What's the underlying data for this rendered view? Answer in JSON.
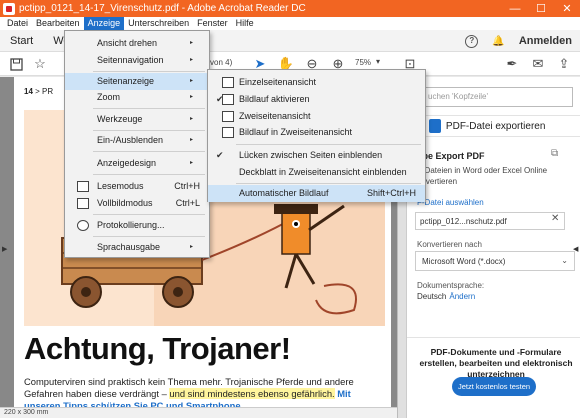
{
  "window": {
    "title": "pctipp_0121_14-17_Virenschutz.pdf - Adobe Acrobat Reader DC",
    "minimize": "—",
    "maximize": "☐",
    "close": "✕"
  },
  "menubar": [
    "Datei",
    "Bearbeiten",
    "Anzeige",
    "Unterschreiben",
    "Fenster",
    "Hilfe"
  ],
  "nav": {
    "tabs": [
      "Start",
      "Werk"
    ],
    "anmelden": "Anmelden",
    "help_icon": "?",
    "bell_icon": "🔔"
  },
  "toolbar": {
    "page_indicator": "von 4)",
    "zoom": "75%",
    "zoom_dropdown": "▾"
  },
  "document": {
    "breadcrumb_num": "14",
    "breadcrumb_text": "> PR",
    "headline": "Achtung, Trojaner!",
    "body_plain1": "Computerviren sind praktisch kein Thema mehr. Trojanische Pferde und andere Gefahren haben diese verdrängt – ",
    "body_highlight": "und sind mindestens ebenso gefährlich.",
    "body_link": " Mit unseren Tipps schützen Sie PC und Smartphone"
  },
  "statusbar": {
    "size": "220 x 300 mm"
  },
  "anzeige_menu": {
    "items": [
      {
        "label": "Ansicht drehen",
        "arrow": "▸"
      },
      {
        "label": "Seitennavigation",
        "arrow": "▸"
      },
      {
        "label": "Seitenanzeige",
        "arrow": "▸"
      },
      {
        "label": "Zoom",
        "arrow": "▸"
      },
      {
        "label": "Werkzeuge",
        "arrow": "▸"
      },
      {
        "label": "Ein-/Ausblenden",
        "arrow": "▸"
      },
      {
        "label": "Anzeigedesign",
        "arrow": "▸"
      },
      {
        "label": "Lesemodus",
        "shortcut": "Ctrl+H"
      },
      {
        "label": "Vollbildmodus",
        "shortcut": "Ctrl+L"
      },
      {
        "label": "Protokollierung..."
      },
      {
        "label": "Sprachausgabe",
        "arrow": "▸"
      }
    ]
  },
  "seitenanzeige_menu": {
    "items": [
      {
        "label": "Einzelseitenansicht"
      },
      {
        "label": "Bildlauf aktivieren",
        "check": "✔"
      },
      {
        "label": "Zweiseitenansicht"
      },
      {
        "label": "Bildlauf in Zweiseitenansicht"
      },
      {
        "label": "Lücken zwischen Seiten einblenden",
        "check": "✔"
      },
      {
        "label": "Deckblatt in Zweiseitenansicht einblenden"
      },
      {
        "label": "Automatischer Bildlauf",
        "shortcut": "Shift+Ctrl+H"
      }
    ]
  },
  "right_panel": {
    "search_placeholder": "uchen 'Kopfzeile'",
    "export_header": "PDF-Datei exportieren",
    "export_title": "obe Export PDF",
    "export_desc": "F-Dateien in Word oder Excel Online onvertieren",
    "choose_file": "F-Datei auswählen",
    "file_name": "pctipp_012...nschutz.pdf",
    "convert_to_label": "Konvertieren nach",
    "convert_to_value": "Microsoft Word (*.docx)",
    "language_label": "Dokumentsprache:",
    "language_value": "Deutsch",
    "language_change": "Ändern",
    "promo_text": "PDF-Dokumente und -Formulare erstellen, bearbeiten und elektronisch unterzeichnen",
    "trial_button": "Jetzt kostenlos testen"
  },
  "colors": {
    "titlebar": "#f26522",
    "accent": "#1e6fc9",
    "menu_highlight": "#cde3f7",
    "art_background": "#fce4cf"
  }
}
